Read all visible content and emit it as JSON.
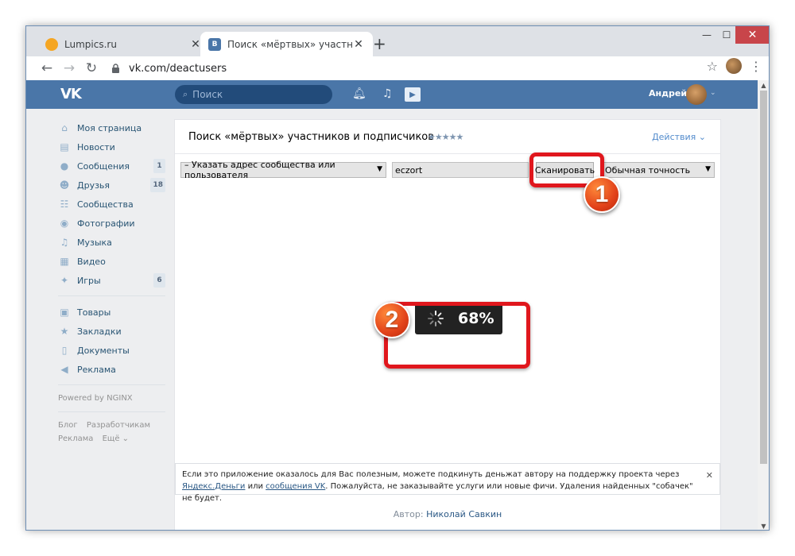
{
  "browser": {
    "tabs": [
      {
        "title": "Lumpics.ru",
        "favicon": "orange-circle-icon"
      },
      {
        "title": "Поиск «мёртвых» участников и",
        "favicon": "vk-icon"
      }
    ],
    "close_glyph": "✕",
    "new_tab": "+",
    "window_controls": {
      "minimize": "—",
      "maximize": "☐",
      "close": "✕"
    },
    "url": "vk.com/deactusers",
    "nav": {
      "back": "←",
      "forward": "→",
      "reload": "↻"
    },
    "star": "☆",
    "menu": "⋮"
  },
  "vk": {
    "logo": "VK",
    "search_placeholder": "Поиск",
    "user_name": "Андрей",
    "sidebar": {
      "items": [
        {
          "label": "Моя страница",
          "icon": "home-icon",
          "glyph": "⌂",
          "badge": ""
        },
        {
          "label": "Новости",
          "icon": "news-icon",
          "glyph": "▤",
          "badge": ""
        },
        {
          "label": "Сообщения",
          "icon": "messages-icon",
          "glyph": "●",
          "badge": "1"
        },
        {
          "label": "Друзья",
          "icon": "friends-icon",
          "glyph": "☻",
          "badge": "18"
        },
        {
          "label": "Сообщества",
          "icon": "communities-icon",
          "glyph": "☷",
          "badge": ""
        },
        {
          "label": "Фотографии",
          "icon": "camera-icon",
          "glyph": "◉",
          "badge": ""
        },
        {
          "label": "Музыка",
          "icon": "music-icon",
          "glyph": "♫",
          "badge": ""
        },
        {
          "label": "Видео",
          "icon": "video-icon",
          "glyph": "▦",
          "badge": ""
        },
        {
          "label": "Игры",
          "icon": "games-icon",
          "glyph": "✦",
          "badge": "6"
        }
      ],
      "items2": [
        {
          "label": "Товары",
          "icon": "shopping-bag-icon",
          "glyph": "▣"
        },
        {
          "label": "Закладки",
          "icon": "bookmarks-star-icon",
          "glyph": "★"
        },
        {
          "label": "Документы",
          "icon": "document-icon",
          "glyph": "▯"
        },
        {
          "label": "Реклама",
          "icon": "megaphone-icon",
          "glyph": "◀"
        }
      ],
      "powered": "Powered by NGINX",
      "footer": [
        "Блог",
        "Разработчикам",
        "Реклама",
        "Ещё ⌄"
      ]
    }
  },
  "app": {
    "title": "Поиск «мёртвых» участников и подписчиков",
    "stars": "★★★★★",
    "actions": "Действия ⌄",
    "target_select": "– Указать адрес сообщества или пользователя",
    "id_input": "eczort",
    "scan_button": "Сканировать",
    "precision_select": "Обычная точность",
    "progress": 68,
    "progress_text": "68%",
    "note_text_1": "Если это приложение оказалось для Вас полезным, можете подкинуть деньжат автору на поддержку проекта через",
    "note_link_1": "Яндекс.Деньги",
    "note_or": " или ",
    "note_link_2": "сообщения VK",
    "note_text_2": ". Пожалуйста, не заказывайте услуги или новые фичи. Удаления найденных \"собачек\" не будет.",
    "note_close": "✕",
    "author_label": "Автор: ",
    "author_name": "Николай Савкин"
  },
  "annotations": {
    "step1": "1",
    "step2": "2",
    "highlight_color": "#e0171d"
  },
  "colors": {
    "vk_blue": "#4a76a8",
    "page_bg": "#edeef0",
    "link": "#2a5885"
  }
}
